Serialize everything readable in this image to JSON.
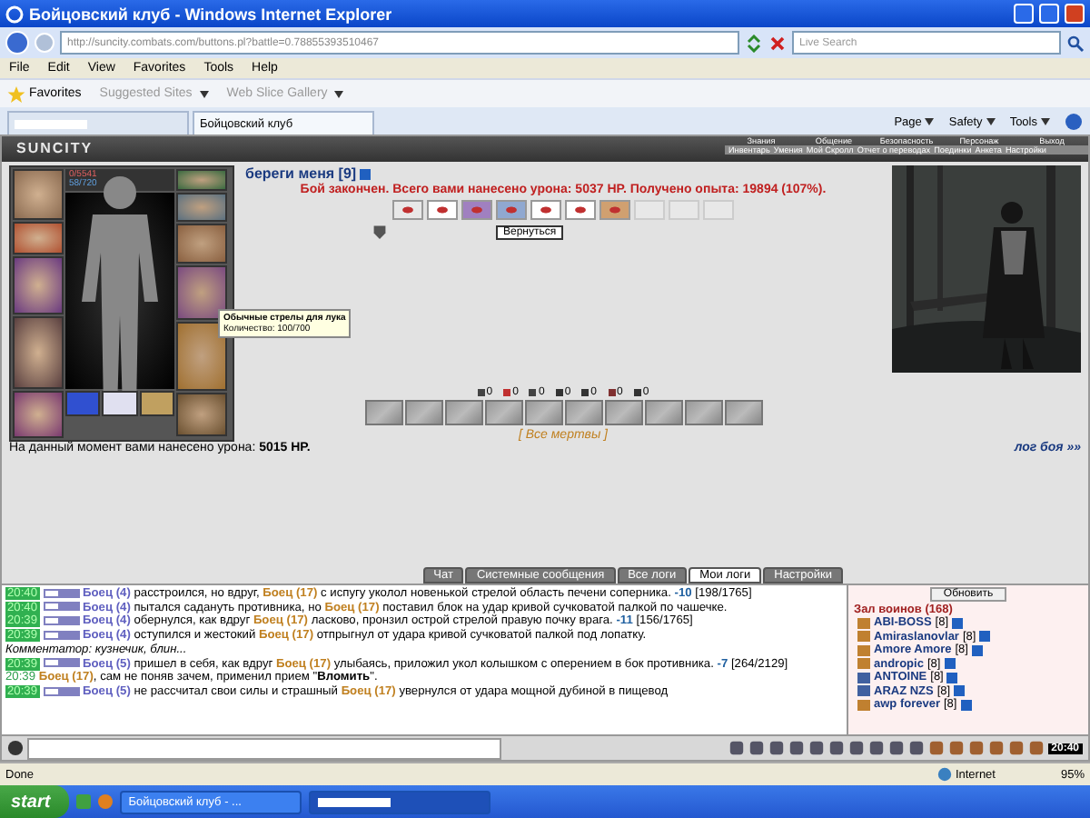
{
  "window": {
    "title": "Бойцовский клуб - Windows Internet Explorer"
  },
  "address_bar": {
    "url": "http://suncity.combats.com/buttons.pl?battle=0.78855393510467"
  },
  "search": {
    "placeholder": "Live Search"
  },
  "menu": [
    "File",
    "Edit",
    "View",
    "Favorites",
    "Tools",
    "Help"
  ],
  "favorites_bar": {
    "favorites": "Favorites",
    "links": [
      "Suggested Sites",
      "Web Slice Gallery"
    ]
  },
  "tabs": [
    {
      "selected": false
    },
    {
      "label": "Бойцовский клуб",
      "selected": true
    }
  ],
  "command_bar": [
    "Page",
    "Safety",
    "Tools"
  ],
  "game": {
    "logo": "SUNCITY",
    "nav_top": [
      "Знания",
      "Общение",
      "Безопасность",
      "Персонаж",
      "Выход"
    ],
    "nav_bottom": [
      "Инвентарь",
      "Умения",
      "Мой Скролл",
      "Отчет о переводах",
      "Поединки",
      "Анкета",
      "Настройки"
    ],
    "character": {
      "hp": "0/5541",
      "mana": "58/720"
    },
    "tooltip": {
      "title": "Обычные стрелы для лука",
      "text": "Количество: 100/700"
    },
    "opponent": "береги меня [9]",
    "result": "Бой закончен. Всего вами нанесено урона: 5037 HP. Получено опыта: 19894 (107%).",
    "return_button": "Вернуться",
    "counters": [
      "0",
      "0",
      "0",
      "0",
      "0",
      "0",
      "0"
    ],
    "all_dead": "[ Все мертвы ]",
    "damage_note": "На данный момент вами нанесено урона: **5015 HP.**",
    "log_link": "лог боя »»"
  },
  "chat": {
    "tabs": [
      {
        "label": "Чат",
        "selected": false
      },
      {
        "label": "Системные сообщения",
        "selected": false
      },
      {
        "label": "Все логи",
        "selected": false
      },
      {
        "label": "Мои логи",
        "selected": true
      },
      {
        "label": "Настройки",
        "selected": false
      }
    ],
    "log": [
      {
        "kind": "hit",
        "time": "20:40",
        "parts": [
          {
            "kind": "enemy",
            "text": "Боец (4)"
          },
          {
            "kind": "text",
            "text": " расстроился, но вдруг, "
          },
          {
            "kind": "self",
            "text": "Боец (17)"
          },
          {
            "kind": "text",
            "text": " с испугу уколол новенькой стрелой область печени соперника. "
          },
          {
            "kind": "damage",
            "text": "-10"
          },
          {
            "kind": "text",
            "text": " [198/1765]"
          }
        ]
      },
      {
        "kind": "hit",
        "time": "20:40",
        "parts": [
          {
            "kind": "enemy",
            "text": "Боец (4)"
          },
          {
            "kind": "text",
            "text": " пытался садануть противника, но "
          },
          {
            "kind": "self",
            "text": "Боец (17)"
          },
          {
            "kind": "text",
            "text": " поставил блок на удар кривой сучковатой палкой по чашечке."
          }
        ]
      },
      {
        "kind": "hit",
        "time": "20:39",
        "parts": [
          {
            "kind": "enemy",
            "text": "Боец (4)"
          },
          {
            "kind": "text",
            "text": " обернулся, как вдруг "
          },
          {
            "kind": "self",
            "text": "Боец (17)"
          },
          {
            "kind": "text",
            "text": " ласково, пронзил острой стрелой правую почку врага. "
          },
          {
            "kind": "damage",
            "text": "-11"
          },
          {
            "kind": "text",
            "text": " [156/1765]"
          }
        ]
      },
      {
        "kind": "hit",
        "time": "20:39",
        "parts": [
          {
            "kind": "enemy",
            "text": "Боец (4)"
          },
          {
            "kind": "text",
            "text": " оступился и жестокий "
          },
          {
            "kind": "self",
            "text": "Боец (17)"
          },
          {
            "kind": "text",
            "text": " отпрыгнул от удара кривой сучковатой палкой под лопатку."
          }
        ]
      },
      {
        "kind": "comment",
        "parts": [
          {
            "kind": "text",
            "text": "Комментатор: кузнечик, блин..."
          }
        ]
      },
      {
        "kind": "hit",
        "time": "20:39",
        "parts": [
          {
            "kind": "enemy",
            "text": "Боец (5)"
          },
          {
            "kind": "text",
            "text": " пришел в себя, как вдруг "
          },
          {
            "kind": "self",
            "text": "Боец (17)"
          },
          {
            "kind": "text",
            "text": " улыбаясь, приложил укол колышком с оперением в бок противника. "
          },
          {
            "kind": "damage",
            "text": "-7"
          },
          {
            "kind": "text",
            "text": " [264/2129]"
          }
        ]
      },
      {
        "kind": "trick",
        "time": "20:39",
        "parts": [
          {
            "kind": "self",
            "text": "Боец (17)"
          },
          {
            "kind": "text",
            "text": ", сам не поняв зачем, применил прием \""
          },
          {
            "kind": "bold",
            "text": "Вломить"
          },
          {
            "kind": "text",
            "text": "\"."
          }
        ]
      },
      {
        "kind": "hit",
        "time": "20:39",
        "parts": [
          {
            "kind": "enemy",
            "text": "Боец (5)"
          },
          {
            "kind": "text",
            "text": " не рассчитал свои силы и страшный "
          },
          {
            "kind": "self",
            "text": "Боец (17)"
          },
          {
            "kind": "text",
            "text": " увернулся от удара мощной дубиной в пищевод"
          }
        ]
      }
    ],
    "clock": "20:40"
  },
  "users": {
    "refresh": "Обновить",
    "title": "Зал воинов (168)",
    "list": [
      {
        "name": "ABI-BOSS",
        "level": "[8]",
        "color": "#c08030"
      },
      {
        "name": "Amiraslanovlar",
        "level": "[8]",
        "color": "#c08030"
      },
      {
        "name": "Amore Amore",
        "level": "[8]",
        "color": "#c08030"
      },
      {
        "name": "andropic",
        "level": "[8]",
        "color": "#c08030"
      },
      {
        "name": "ANTOINE",
        "level": "[8]",
        "color": "#4060a0"
      },
      {
        "name": "ARAZ NZS",
        "level": "[8]",
        "color": "#4060a0"
      },
      {
        "name": "awp forever",
        "level": "[8]",
        "color": "#c08030"
      }
    ]
  },
  "status_bar": {
    "text": "Done",
    "zone": "Internet",
    "zoom": "95%"
  },
  "taskbar": {
    "start": "start",
    "windows": [
      {
        "label": "Бойцовский клуб - ...",
        "selected": false
      },
      {
        "selected": true
      }
    ]
  }
}
